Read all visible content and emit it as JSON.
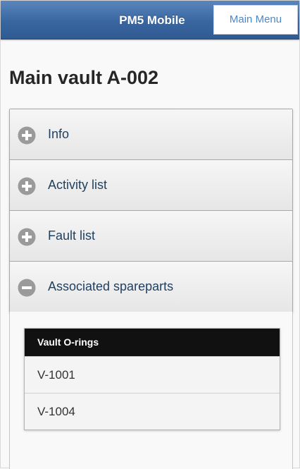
{
  "header": {
    "title": "PM5 Mobile",
    "main_menu_label": "Main Menu"
  },
  "page": {
    "title": "Main vault A-002"
  },
  "sections": [
    {
      "label": "Info",
      "icon": "plus-circle-icon",
      "expanded": false
    },
    {
      "label": "Activity list",
      "icon": "plus-circle-icon",
      "expanded": false
    },
    {
      "label": "Fault list",
      "icon": "plus-circle-icon",
      "expanded": false
    },
    {
      "label": "Associated spareparts",
      "icon": "minus-circle-icon",
      "expanded": true
    }
  ],
  "spareparts": {
    "group_label": "Vault O-rings",
    "items": [
      "V-1001",
      "V-1004"
    ]
  },
  "colors": {
    "header_blue": "#3a66a0",
    "link_blue": "#4d87c7",
    "icon_gray": "#9a9a9a",
    "divider_black": "#111111"
  }
}
